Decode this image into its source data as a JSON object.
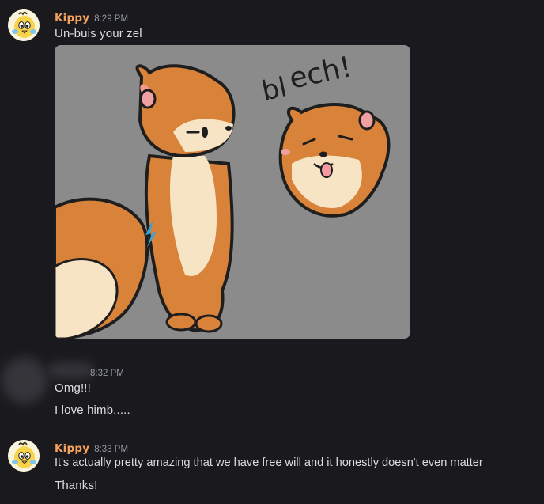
{
  "messages": [
    {
      "author": "Kippy",
      "time": "8:29 PM",
      "lines": [
        "Un-buis your zel"
      ],
      "attachment": {
        "type": "image",
        "caption_on_image": "blech!"
      }
    },
    {
      "author": "",
      "time": "8:32 PM",
      "lines": [
        "Omg!!!",
        "I love himb....."
      ]
    },
    {
      "author": "Kippy",
      "time": "8:33 PM",
      "lines": [
        "It's actually pretty amazing that we have free will and it honestly doesn't even matter",
        "Thanks!"
      ]
    }
  ],
  "colors": {
    "background": "#1a1a1e",
    "username": "#f6a15c",
    "text": "#dbdee1",
    "timestamp": "#949ba4"
  }
}
